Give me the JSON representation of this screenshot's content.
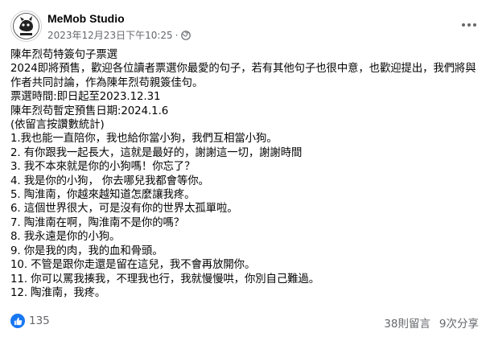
{
  "header": {
    "page_name": "MeMob Studio",
    "timestamp": "2023年12月23日下午10:25",
    "separator": "·",
    "privacy_icon": "globe-icon",
    "more_icon": "more-horizontal-icon",
    "avatar_icon": "memob-studio-logo"
  },
  "post": {
    "lines": [
      "陳年烈苟特簽句子票選",
      "2024即將預售，歡迎各位讀者票選你最愛的句子，若有其他句子也很中意，也歡迎提出，我們將與",
      "作者共同討論，作為陳年烈苟親簽佳句。",
      "票選時間:即日起至2023.12.31",
      "陳年烈苟暫定預售日期:2024.1.6",
      "(依留言按讚數統計)",
      "1.我也能一直陪你，我也給你當小狗，我們互相當小狗。",
      "2. 有你跟我一起長大，這就是最好的，謝謝這一切，謝謝時間",
      "3. 我不本來就是你的小狗嗎！你忘了？",
      "4. 我是你的小狗，  你去哪兒我都會等你。",
      "5. 陶淮南，你越來越知道怎麼讓我疼。",
      "6. 這個世界很大，可是沒有你的世界太孤單啦。",
      "7. 陶淮南在啊，陶淮南不是你的嗎？",
      "8. 我永遠是你的小狗。",
      "9. 你是我的肉，我的血和骨頭。",
      "10. 不管是跟你走還是留在這兒，我不會再放開你。",
      "11. 你可以罵我揍我，不理我也行，我就慢慢哄，你別自己難過。",
      "12. 陶淮南，我疼。"
    ]
  },
  "footer": {
    "reaction_icon": "thumbs-up-icon",
    "reaction_count": "135",
    "comments": "38則留言",
    "shares": "9次分享"
  },
  "colors": {
    "primary_text": "#050505",
    "secondary_text": "#65676b",
    "like_blue": "#1877f2"
  }
}
